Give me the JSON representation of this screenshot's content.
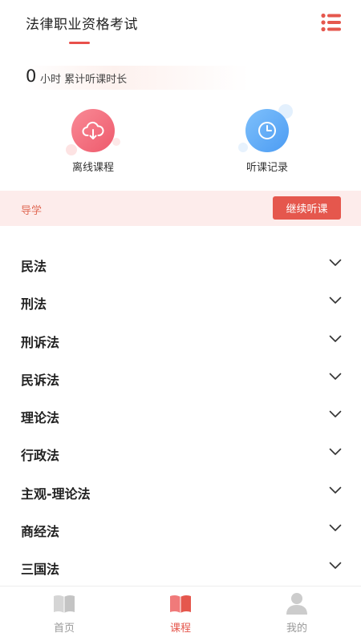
{
  "header": {
    "title": "法律职业资格考试",
    "menu_icon": "list-menu-icon"
  },
  "study_time": {
    "hours": "0",
    "unit_label": "小时 累计听课时长"
  },
  "shortcuts": [
    {
      "label": "离线课程",
      "icon": "cloud-download-icon"
    },
    {
      "label": "听课记录",
      "icon": "clock-icon"
    }
  ],
  "guide": {
    "label": "导学",
    "continue_label": "继续听课"
  },
  "subjects": [
    {
      "name": "民法"
    },
    {
      "name": "刑法"
    },
    {
      "name": "刑诉法"
    },
    {
      "name": "民诉法"
    },
    {
      "name": "理论法"
    },
    {
      "name": "行政法"
    },
    {
      "name": "主观-理论法"
    },
    {
      "name": "商经法"
    },
    {
      "name": "三国法"
    }
  ],
  "tabbar": {
    "items": [
      {
        "label": "首页",
        "icon": "book-icon",
        "active": false
      },
      {
        "label": "课程",
        "icon": "book-open-icon",
        "active": true
      },
      {
        "label": "我的",
        "icon": "user-icon",
        "active": false
      }
    ]
  },
  "colors": {
    "accent": "#e5574d",
    "guide_bg": "#fdeceb",
    "offline_icon": "#ee5a6c",
    "history_icon": "#4c9cf3",
    "tab_inactive": "#999999"
  }
}
